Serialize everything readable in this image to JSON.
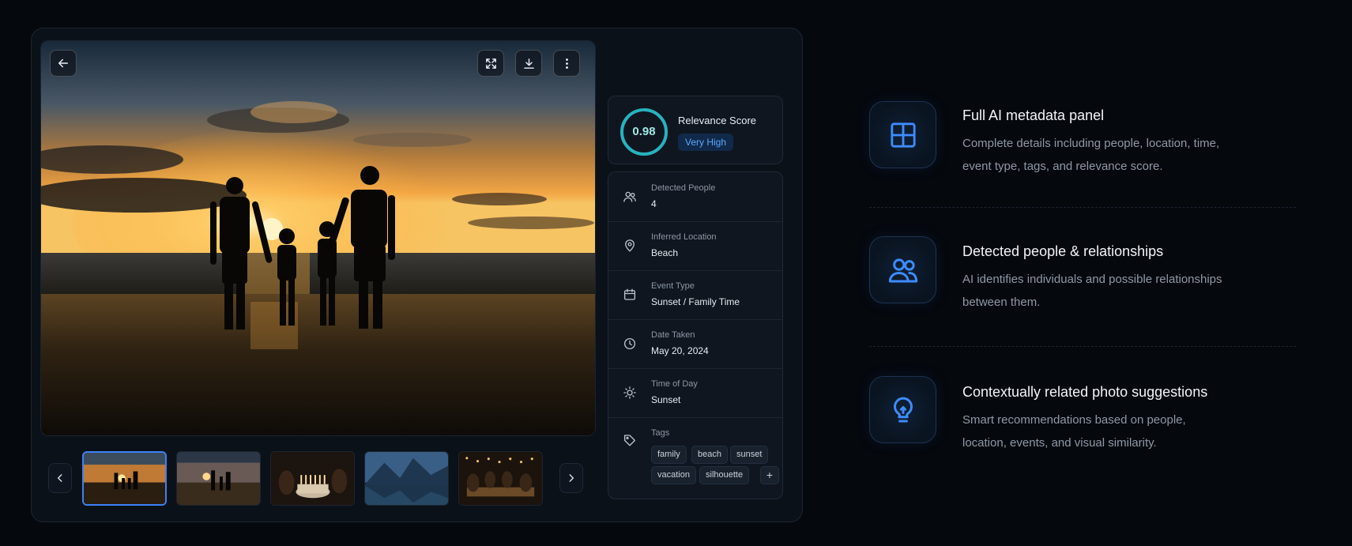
{
  "viewer": {
    "back_icon": "arrow-left-icon",
    "fullscreen_icon": "expand-icon",
    "download_icon": "download-icon",
    "more_icon": "more-vertical-icon"
  },
  "thumbnails": [
    {
      "scene": "family-beach-sunset",
      "active": true
    },
    {
      "scene": "family-beach-dusk",
      "active": false
    },
    {
      "scene": "birthday-cake",
      "active": false
    },
    {
      "scene": "mountain-lake",
      "active": false
    },
    {
      "scene": "dinner-party",
      "active": false
    }
  ],
  "relevance": {
    "score": "0.98",
    "score_fraction": 0.98,
    "title": "Relevance Score",
    "badge": "Very High"
  },
  "metadata": [
    {
      "icon": "people-icon",
      "label": "Detected People",
      "value": "4"
    },
    {
      "icon": "location-pin-icon",
      "label": "Inferred Location",
      "value": "Beach"
    },
    {
      "icon": "calendar-icon",
      "label": "Event Type",
      "value": "Sunset / Family Time"
    },
    {
      "icon": "clock-icon",
      "label": "Date Taken",
      "value": "May 20, 2024"
    },
    {
      "icon": "sun-icon",
      "label": "Time of Day",
      "value": "Sunset"
    }
  ],
  "tags": {
    "label": "Tags",
    "icon": "tag-icon",
    "items": [
      "family",
      "beach",
      "sunset",
      "vacation",
      "silhouette"
    ],
    "add_label": "+"
  },
  "features": [
    {
      "icon": "grid-panel-icon",
      "title": "Full AI metadata panel",
      "desc_line1": "Complete details including people, location, time,",
      "desc_line2": "event type, tags, and relevance score."
    },
    {
      "icon": "people-icon",
      "title": "Detected people & relationships",
      "desc_line1": "AI identifies individuals and possible relationships",
      "desc_line2": "between them."
    },
    {
      "icon": "lightbulb-icon",
      "title": "Contextually related photo suggestions",
      "desc_line1": "Smart recommendations based on people,",
      "desc_line2": "location, events, and visual similarity."
    }
  ],
  "colors": {
    "accent": "#3b82f6",
    "ring": "#27b3bf",
    "icon_blue": "#3e8cff"
  }
}
